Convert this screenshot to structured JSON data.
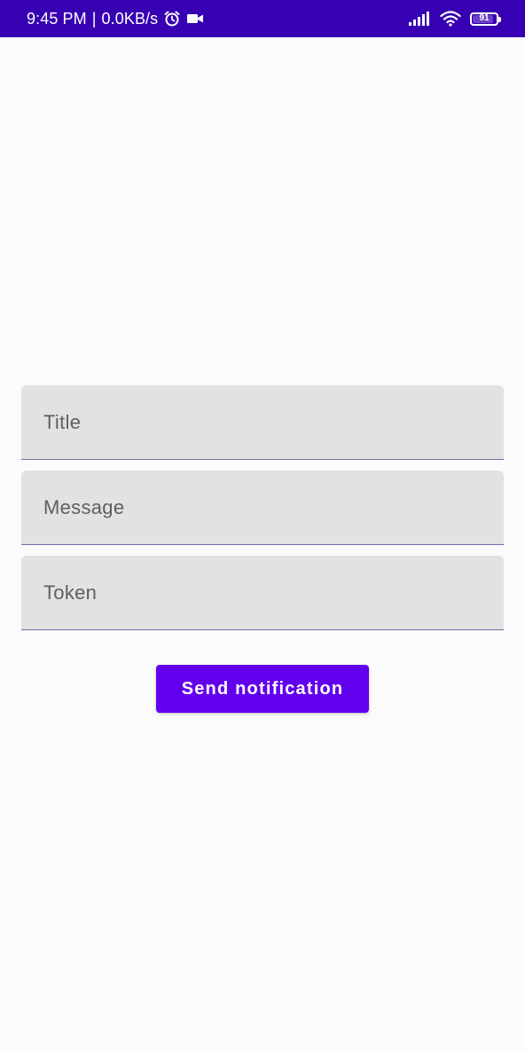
{
  "status_bar": {
    "time": "9:45 PM",
    "separator": "|",
    "network_speed": "0.0KB/s",
    "battery_level": "91",
    "battery_fraction": 0.91,
    "background_color": "#3700b3",
    "icons": [
      "alarm-icon",
      "video-camera-icon",
      "signal-icon",
      "wifi-icon",
      "battery-icon"
    ]
  },
  "form": {
    "title_placeholder": "Title",
    "message_placeholder": "Message",
    "token_placeholder": "Token",
    "field_background": "#e2e2e2"
  },
  "actions": {
    "send_label": "Send notification",
    "accent_color": "#6200ee"
  }
}
